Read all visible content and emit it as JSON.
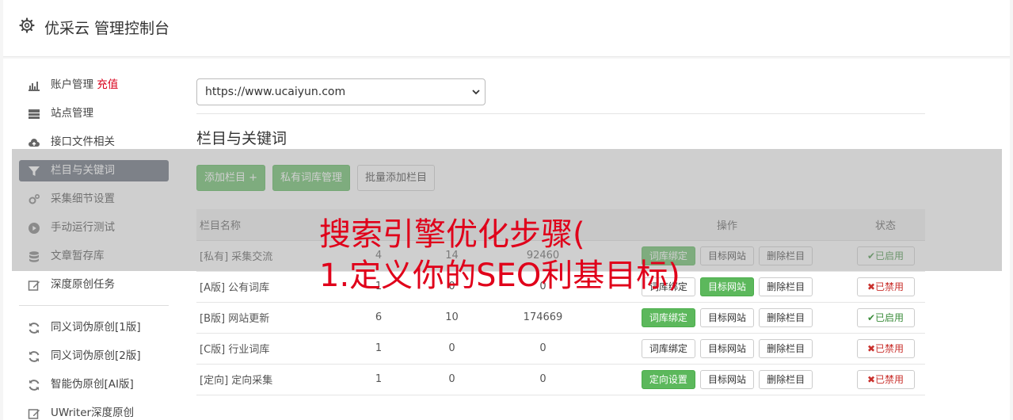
{
  "header": {
    "title": "优采云 管理控制台",
    "icon": "gear-icon"
  },
  "sidebar": {
    "group1": [
      {
        "label": "账户管理",
        "extra": "充值",
        "icon": "bar-chart-icon",
        "active": false
      },
      {
        "label": "站点管理",
        "icon": "server-icon",
        "active": false
      },
      {
        "label": "接口文件相关",
        "icon": "cloud-upload-icon",
        "active": false
      },
      {
        "label": "栏目与关键词",
        "icon": "filter-icon",
        "active": true
      },
      {
        "label": "采集细节设置",
        "icon": "gears-icon",
        "active": false
      },
      {
        "label": "手动运行测试",
        "icon": "play-circle-icon",
        "active": false
      },
      {
        "label": "文章暂存库",
        "icon": "database-icon",
        "active": false
      },
      {
        "label": "深度原创任务",
        "icon": "edit-icon",
        "active": false
      }
    ],
    "group2": [
      {
        "label": "同义词伪原创[1版]",
        "icon": "refresh-icon"
      },
      {
        "label": "同义词伪原创[2版]",
        "icon": "refresh-icon"
      },
      {
        "label": "智能伪原创[AI版]",
        "icon": "refresh-icon"
      },
      {
        "label": "UWriter深度原创",
        "icon": "edit-icon"
      }
    ]
  },
  "site_select": {
    "value": "https://www.ucaiyun.com"
  },
  "section": {
    "title": "栏目与关键词"
  },
  "buttons": {
    "add": "添加栏目 +",
    "private": "私有词库管理",
    "batch": "批量添加栏目"
  },
  "table": {
    "headers": [
      "栏目名称",
      "",
      "",
      "",
      "操作",
      "状态"
    ],
    "rows": [
      {
        "name": "[私有] 采集交流",
        "color": "green",
        "c1": "4",
        "c2": "14",
        "c3": "92460",
        "op1": "词库绑定",
        "op1_green": true,
        "op2": "目标网站",
        "op2_green": false,
        "op3": "删除栏目",
        "status": "已启用",
        "on": true
      },
      {
        "name": "[A版] 公有词库",
        "color": "black",
        "c1": "1",
        "c2": "0",
        "c3": "0",
        "op1": "词库绑定",
        "op1_green": false,
        "op2": "目标网站",
        "op2_green": true,
        "op3": "删除栏目",
        "status": "已禁用",
        "on": false
      },
      {
        "name": "[B版] 网站更新",
        "color": "blue",
        "c1": "6",
        "c2": "10",
        "c3": "174669",
        "op1": "词库绑定",
        "op1_green": true,
        "op2": "目标网站",
        "op2_green": false,
        "op3": "删除栏目",
        "status": "已启用",
        "on": true
      },
      {
        "name": "[C版] 行业词库",
        "color": "red",
        "c1": "1",
        "c2": "0",
        "c3": "0",
        "op1": "词库绑定",
        "op1_green": false,
        "op2": "目标网站",
        "op2_green": false,
        "op3": "删除栏目",
        "status": "已禁用",
        "on": false
      },
      {
        "name": "[定向] 定向采集",
        "color": "purple",
        "c1": "1",
        "c2": "0",
        "c3": "0",
        "op1": "定向设置",
        "op1_green": true,
        "op2": "目标网站",
        "op2_green": false,
        "op3": "删除栏目",
        "status": "已禁用",
        "on": false
      }
    ]
  },
  "overlay": {
    "line1": "搜索引擎优化步骤(",
    "line2": "1.定义你的SEO利基目标)"
  }
}
